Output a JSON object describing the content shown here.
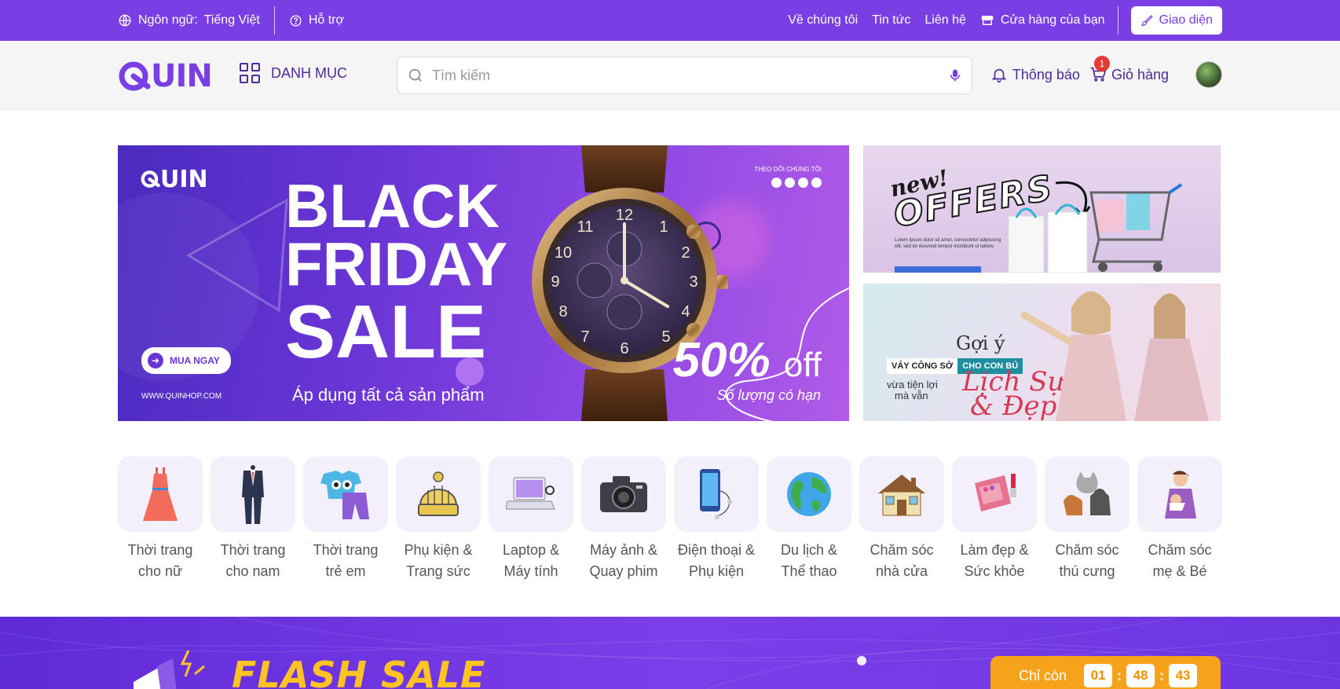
{
  "topbar": {
    "language_label": "Ngôn ngữ:",
    "language_value": "Tiếng Việt",
    "support": "Hỗ trợ",
    "about": "Về chúng tôi",
    "news": "Tin tức",
    "contact": "Liên hệ",
    "your_store": "Cửa hàng của bạn",
    "theme_button": "Giao diện"
  },
  "header": {
    "logo": "UIN",
    "category_label": "DANH MỤC",
    "search_placeholder": "Tìm kiếm",
    "notifications": "Thông báo",
    "cart": "Giỏ hàng",
    "cart_count": "1"
  },
  "banner_main": {
    "logo": "UIN",
    "title_line1": "BLACK",
    "title_line2": "FRIDAY",
    "title_line3": "SALE",
    "subtitle": "Áp dụng tất cả sản phẩm",
    "cta": "MUA NGAY",
    "url": "WWW.QUINHOP.COM",
    "follow": "THEO DÕI CHÚNG TÔI",
    "discount": "50%",
    "discount_suffix": "off",
    "limited": "Số lượng có hạn"
  },
  "banner_offers": {
    "new": "new!",
    "offers": "OFFERS",
    "lorem": "Lorem ipsum dolor sit amet, consectetur adipiscing elit, sed do eiusmod tempor incididunt ut labore."
  },
  "banner_fashion": {
    "title": "Gợi ý",
    "tag1": "VÁY CÔNG SỞ",
    "tag2": "CHO CON BÚ",
    "line1": "vừa tiện lợi",
    "line2": "mà vẫn",
    "script1": "Lịch Sự",
    "script2": "& Đẹp"
  },
  "categories": [
    {
      "line1": "Thời trang",
      "line2": "cho nữ",
      "icon": "dress-icon"
    },
    {
      "line1": "Thời trang",
      "line2": "cho nam",
      "icon": "suit-icon"
    },
    {
      "line1": "Thời trang",
      "line2": "trẻ em",
      "icon": "kids-clothes-icon"
    },
    {
      "line1": "Phụ kiện &",
      "line2": "Trang sức",
      "icon": "beanie-icon"
    },
    {
      "line1": "Laptop &",
      "line2": "Máy tính",
      "icon": "laptop-icon"
    },
    {
      "line1": "Máy ảnh &",
      "line2": "Quay phim",
      "icon": "camera-icon"
    },
    {
      "line1": "Điện thoại &",
      "line2": "Phụ kiện",
      "icon": "phone-icon"
    },
    {
      "line1": "Du lịch &",
      "line2": "Thể thao",
      "icon": "globe-icon"
    },
    {
      "line1": "Chăm sóc",
      "line2": "nhà cửa",
      "icon": "house-icon"
    },
    {
      "line1": "Làm đẹp &",
      "line2": "Sức khỏe",
      "icon": "makeup-icon"
    },
    {
      "line1": "Chăm sóc",
      "line2": "thú cưng",
      "icon": "pets-icon"
    },
    {
      "line1": "Chăm sóc",
      "line2": "mẹ & Bé",
      "icon": "mother-baby-icon"
    }
  ],
  "flash_sale": {
    "title": "FLASH SALE",
    "remaining_label": "Chỉ còn",
    "hours": "01",
    "minutes": "48",
    "seconds": "43"
  },
  "colors": {
    "primary": "#7a3fe4",
    "accent_orange": "#f7a21b",
    "flash_yellow": "#ffc423",
    "badge_red": "#e53935"
  }
}
